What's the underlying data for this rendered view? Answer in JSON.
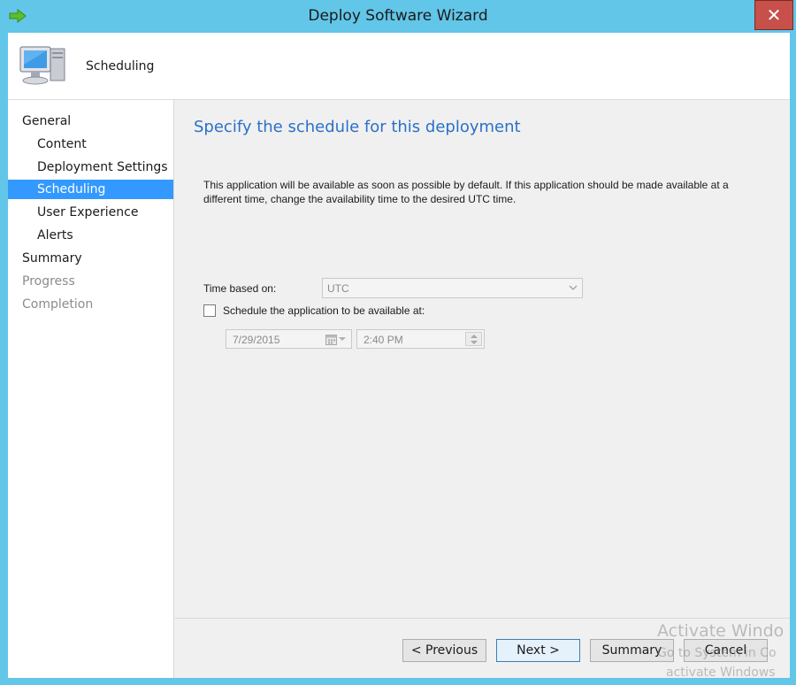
{
  "window": {
    "title": "Deploy Software Wizard",
    "close_label": "✕",
    "accent_color": "#62c6e8"
  },
  "header": {
    "title": "Scheduling",
    "icon": "computer-icon"
  },
  "nav": {
    "items": [
      {
        "label": "General",
        "state": "normal"
      },
      {
        "label": "Content",
        "state": "normal"
      },
      {
        "label": "Deployment Settings",
        "state": "normal"
      },
      {
        "label": "Scheduling",
        "state": "active"
      },
      {
        "label": "User Experience",
        "state": "normal"
      },
      {
        "label": "Alerts",
        "state": "normal"
      },
      {
        "label": "Summary",
        "state": "normal"
      },
      {
        "label": "Progress",
        "state": "disabled"
      },
      {
        "label": "Completion",
        "state": "disabled"
      }
    ]
  },
  "main": {
    "title": "Specify the schedule for this deployment",
    "description": "This application will be available as soon as possible by default. If this application should be made available at a different time, change the availability time to the desired UTC time.",
    "time_based_on_label": "Time based on:",
    "time_based_on_value": "UTC",
    "schedule_checkbox_label": "Schedule the application to be available at:",
    "schedule_checked": false,
    "date_value": "7/29/2015",
    "time_value": "2:40 PM"
  },
  "buttons": {
    "previous": "< Previous",
    "next": "Next >",
    "summary": "Summary",
    "cancel": "Cancel"
  },
  "watermark": {
    "line1": "Activate Windo",
    "line2": "Go to System in Co",
    "line3": "activate Windows"
  }
}
